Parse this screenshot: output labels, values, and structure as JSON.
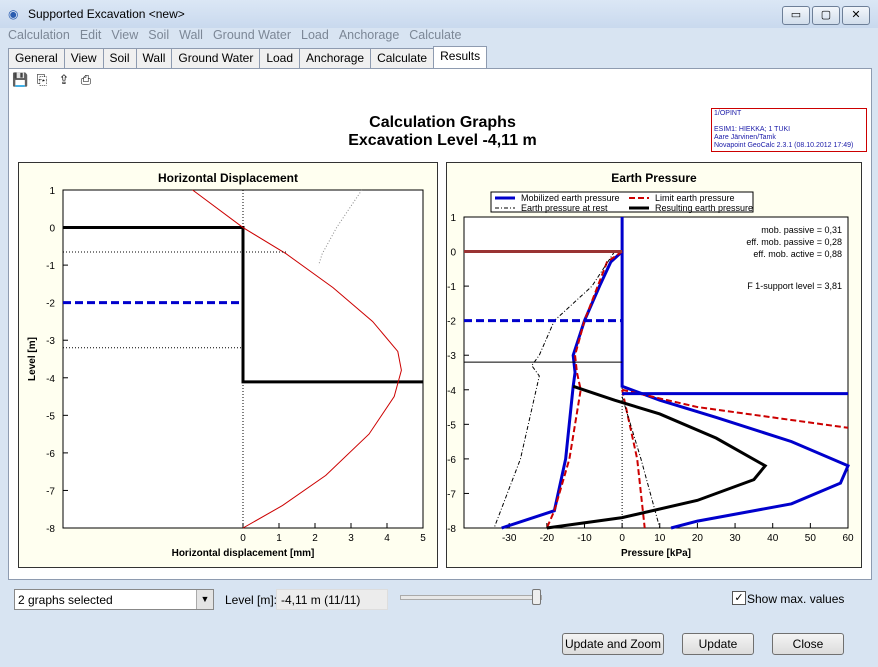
{
  "window": {
    "title": "Supported Excavation <new>",
    "minimize": "▭",
    "maximize": "▢",
    "close": "✕"
  },
  "menu": [
    "Calculation",
    "Edit",
    "View",
    "Soil",
    "Wall",
    "Ground Water",
    "Load",
    "Anchorage",
    "Calculate"
  ],
  "tabs": [
    "General",
    "View",
    "Soil",
    "Wall",
    "Ground Water",
    "Load",
    "Anchorage",
    "Calculate",
    "Results"
  ],
  "active_tab": "Results",
  "toolbar": [
    "save-icon",
    "copy-icon",
    "export-icon",
    "print-icon"
  ],
  "header": {
    "title": "Calculation Graphs",
    "subtitle": "Excavation Level -4,11 m"
  },
  "info": [
    "1/OPINT",
    "",
    "ESIM1: HIEKKA; 1 TUKI",
    "Aare Järvinen/Tamk",
    "Novapoint GeoCalc 2.3.1 (08.10.2012 17:49)"
  ],
  "chart_data": [
    {
      "type": "line",
      "title": "Horizontal Displacement",
      "xlabel": "Horizontal displacement [mm]",
      "ylabel": "Level [m]",
      "xlim": [
        -5,
        5
      ],
      "ylim": [
        -8,
        1
      ],
      "xticks": [
        0,
        1,
        2,
        3,
        4,
        5
      ],
      "yticks": [
        1,
        0,
        -1,
        -2,
        -3,
        -4,
        -5,
        -6,
        -7,
        -8
      ],
      "series": [
        {
          "role": "wall",
          "color": "#000000",
          "x": [
            -5,
            0,
            0,
            5
          ],
          "y": [
            0,
            0,
            -4.11,
            -4.11
          ]
        },
        {
          "role": "water",
          "color": "#0000cc",
          "x": [
            -5,
            0
          ],
          "y": [
            -2,
            -2
          ]
        },
        {
          "role": "displacement",
          "color": "#cc0000",
          "x": [
            -1.4,
            0,
            1.2,
            2.5,
            3.6,
            4.3,
            4.4,
            4.2,
            3.5,
            2.3,
            1.1,
            0
          ],
          "y": [
            1,
            0,
            -0.7,
            -1.6,
            -2.5,
            -3.3,
            -3.8,
            -4.5,
            -5.5,
            -6.6,
            -7.4,
            -8
          ]
        },
        {
          "role": "previous",
          "color": "#888888",
          "x": [
            3.3,
            2.6,
            2.2,
            2.1
          ],
          "y": [
            1,
            0,
            -0.7,
            -1
          ]
        },
        {
          "role": "ref1",
          "color": "#000000",
          "x": [
            -5,
            1.2
          ],
          "y": [
            -0.65,
            -0.65
          ]
        },
        {
          "role": "ref2",
          "color": "#000000",
          "x": [
            -5,
            0
          ],
          "y": [
            -3.2,
            -3.2
          ]
        }
      ]
    },
    {
      "type": "line",
      "title": "Earth Pressure",
      "xlabel": "Pressure [kPa]",
      "ylabel": "Level [m]",
      "xlim": [
        -42,
        60
      ],
      "ylim": [
        -8,
        1
      ],
      "xticks": [
        -30,
        -20,
        -10,
        0,
        10,
        20,
        30,
        40,
        50,
        60
      ],
      "yticks": [
        1,
        0,
        -1,
        -2,
        -3,
        -4,
        -5,
        -6,
        -7,
        -8
      ],
      "legend": [
        "Mobilized earth pressure",
        "Limit earth pressure",
        "Earth pressure at rest",
        "Resulting earth pressure"
      ],
      "annotations": [
        "mob. passive = 0,31",
        "eff. mob. passive = 0,28",
        "eff. mob. active = 0,88",
        "F 1-support level = 3,81"
      ],
      "series": [
        {
          "name": "Mobilized earth pressure",
          "color": "#0000cc",
          "x": [
            0,
            -3,
            -6,
            -10,
            -13,
            -12.5,
            -13,
            -15,
            -18,
            -32
          ],
          "y": [
            0,
            -0.3,
            -1,
            -2,
            -3,
            -3.5,
            -3.9,
            -6,
            -7.5,
            -8
          ]
        },
        {
          "name": "Mobilized earth pressure",
          "color": "#0000cc",
          "x": [
            0,
            0,
            10,
            25,
            45,
            60,
            58,
            45,
            20,
            13
          ],
          "y": [
            1,
            -3.9,
            -4.3,
            -4.8,
            -5.5,
            -6.2,
            -6.7,
            -7.3,
            -7.8,
            -8
          ]
        },
        {
          "name": "Limit earth pressure",
          "color": "#cc0000",
          "x": [
            0,
            -4,
            -10,
            -12.5,
            -12,
            -11,
            -14,
            -18,
            -20
          ],
          "y": [
            0,
            -0.3,
            -2,
            -3,
            -3.5,
            -4,
            -6,
            -7.5,
            -8
          ]
        },
        {
          "name": "Limit earth pressure",
          "color": "#cc0000",
          "x": [
            0,
            2,
            4,
            6
          ],
          "y": [
            -4,
            -5,
            -6,
            -8
          ]
        },
        {
          "name": "Limit earth pressure",
          "color": "#cc0000",
          "x": [
            0,
            20,
            40,
            60
          ],
          "y": [
            -4,
            -4.5,
            -4.8,
            -5.1
          ]
        },
        {
          "name": "Earth pressure at rest",
          "color": "#000000",
          "x": [
            -2,
            -8,
            -18,
            -22,
            -24,
            -22,
            -27,
            -34
          ],
          "y": [
            0,
            -1,
            -2,
            -3,
            -3.3,
            -3.6,
            -6,
            -8
          ]
        },
        {
          "name": "Earth pressure at rest",
          "color": "#000000",
          "x": [
            0,
            5,
            10
          ],
          "y": [
            -4.2,
            -6,
            -8
          ]
        },
        {
          "name": "Resulting earth pressure",
          "color": "#000000",
          "x": [
            -13,
            -2,
            10,
            25,
            38,
            35,
            20,
            0,
            -20
          ],
          "y": [
            -3.9,
            -4.3,
            -4.7,
            -5.4,
            -6.2,
            -6.6,
            -7.2,
            -7.7,
            -8
          ]
        }
      ]
    }
  ],
  "bottom": {
    "graphs_select": "2 graphs selected",
    "level_label": "Level [m]:",
    "level_value": "-4,11 m (11/11)",
    "slider_position": 1.0,
    "show_max_label": "Show max. values",
    "show_max_checked": true
  },
  "buttons": {
    "update_zoom": "Update and Zoom",
    "update": "Update",
    "close": "Close"
  }
}
